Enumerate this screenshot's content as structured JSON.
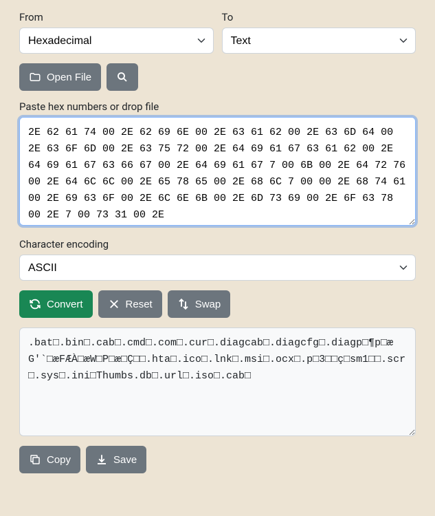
{
  "from": {
    "label": "From",
    "value": "Hexadecimal"
  },
  "to": {
    "label": "To",
    "value": "Text"
  },
  "buttons": {
    "openFile": "Open File",
    "convert": "Convert",
    "reset": "Reset",
    "swap": "Swap",
    "copy": "Copy",
    "save": "Save"
  },
  "input": {
    "label": "Paste hex numbers or drop file",
    "value": "2E 62 61 74 00 2E 62 69 6E 00 2E 63 61 62 00 2E 63 6D 64 00 2E 63 6F 6D 00 2E 63 75 72 00 2E 64 69 61 67 63 61 62 00 2E 64 69 61 67 63 66 67 00 2E 64 69 61 67 7 00 6B 00 2E 64 72 76 00 2E 64 6C 6C 00 2E 65 78 65 00 2E 68 6C 7 00 00 2E 68 74 61 00 2E 69 63 6F 00 2E 6C 6E 6B 00 2E 6D 73 69 00 2E 6F 63 78 00 2E 7 00 73 31 00 2E"
  },
  "encoding": {
    "label": "Character encoding",
    "value": "ASCII"
  },
  "output": {
    "value": ".bat□.bin□.cab□.cmd□.com□.cur□.diagcab□.diagcfg□.diagp□¶p□æG'`□æFÆÀ□æW□P□æ□Ç□□.hta□.ico□.lnk□.msi□.ocx□.p□3□□ç□sm1□□.scr□.sys□.ini□Thumbs.db□.url□.iso□.cab□"
  }
}
